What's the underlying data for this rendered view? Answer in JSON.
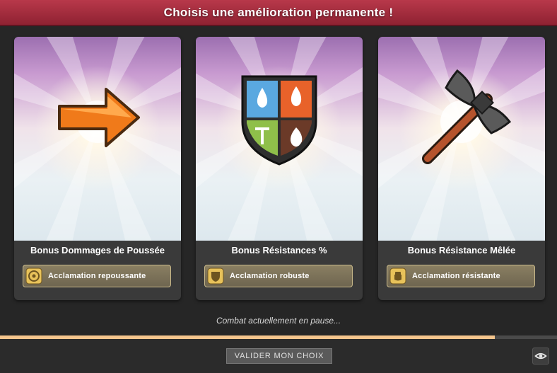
{
  "header": {
    "title": "Choisis une amélioration permanente !"
  },
  "cards": [
    {
      "title": "Bonus Dommages de Poussée",
      "reward": "Acclamation repoussante",
      "art_icon": "orange-arrow-icon",
      "reward_icon": "target-medal-icon"
    },
    {
      "title": "Bonus Résistances %",
      "reward": "Acclamation robuste",
      "art_icon": "elemental-shield-icon",
      "reward_icon": "shield-medal-icon"
    },
    {
      "title": "Bonus Résistance Mêlée",
      "reward": "Acclamation résistante",
      "art_icon": "battle-axe-icon",
      "reward_icon": "fist-medal-icon"
    }
  ],
  "status": {
    "text": "Combat actuellement en pause..."
  },
  "progress": {
    "fraction": 0.888
  },
  "footer": {
    "validate_label": "VALIDER MON CHOIX",
    "eye_icon": "eye-icon"
  },
  "colors": {
    "header": "#a02c3c",
    "progress": "#f4c58d",
    "reward_bg": "#7d7359",
    "reward_border": "#c9b98a"
  }
}
